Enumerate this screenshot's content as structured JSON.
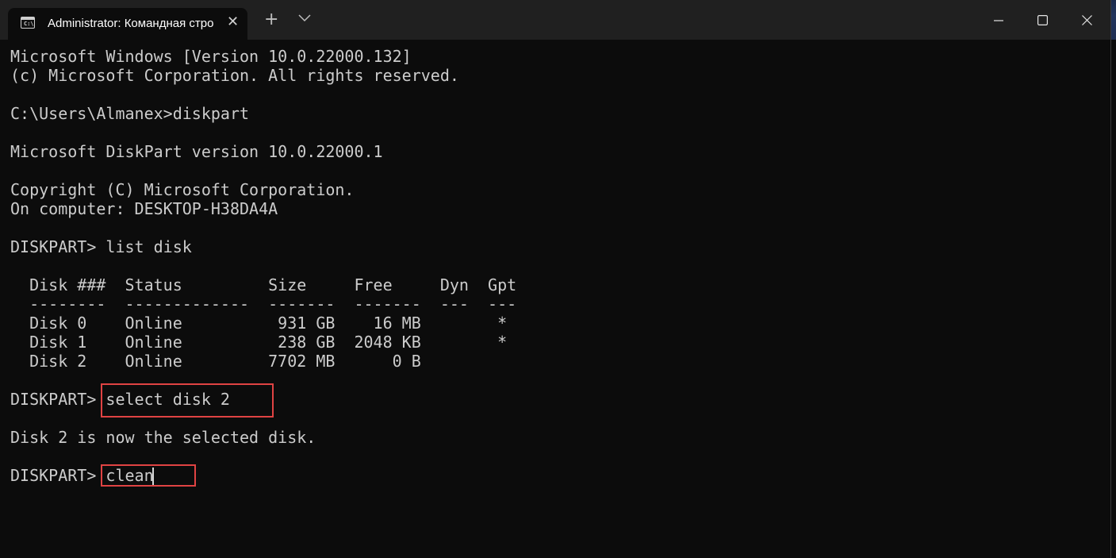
{
  "window": {
    "tab_title": "Administrator: Командная стро",
    "tab_icon": "cmd-icon",
    "close_tab_glyph": "✕",
    "new_tab_glyph": "+",
    "minimize_glyph": "─",
    "maximize_glyph": "☐",
    "close_glyph": "✕"
  },
  "terminal": {
    "lines": [
      "Microsoft Windows [Version 10.0.22000.132]",
      "(c) Microsoft Corporation. All rights reserved.",
      "",
      "C:\\Users\\Almanex>diskpart",
      "",
      "Microsoft DiskPart version 10.0.22000.1",
      "",
      "Copyright (C) Microsoft Corporation.",
      "On computer: DESKTOP-H38DA4A",
      "",
      "DISKPART> list disk",
      "",
      "  Disk ###  Status         Size     Free     Dyn  Gpt",
      "  --------  -------------  -------  -------  ---  ---",
      "  Disk 0    Online          931 GB    16 MB        *",
      "  Disk 1    Online          238 GB  2048 KB        *",
      "  Disk 2    Online         7702 MB      0 B",
      "",
      "DISKPART> select disk 2",
      "",
      "Disk 2 is now the selected disk.",
      "",
      "DISKPART> clean"
    ]
  },
  "colors": {
    "terminal_bg": "#0c0c0c",
    "terminal_text": "#cccccc",
    "titlebar_bg": "#202020",
    "highlight": "#e04343"
  }
}
